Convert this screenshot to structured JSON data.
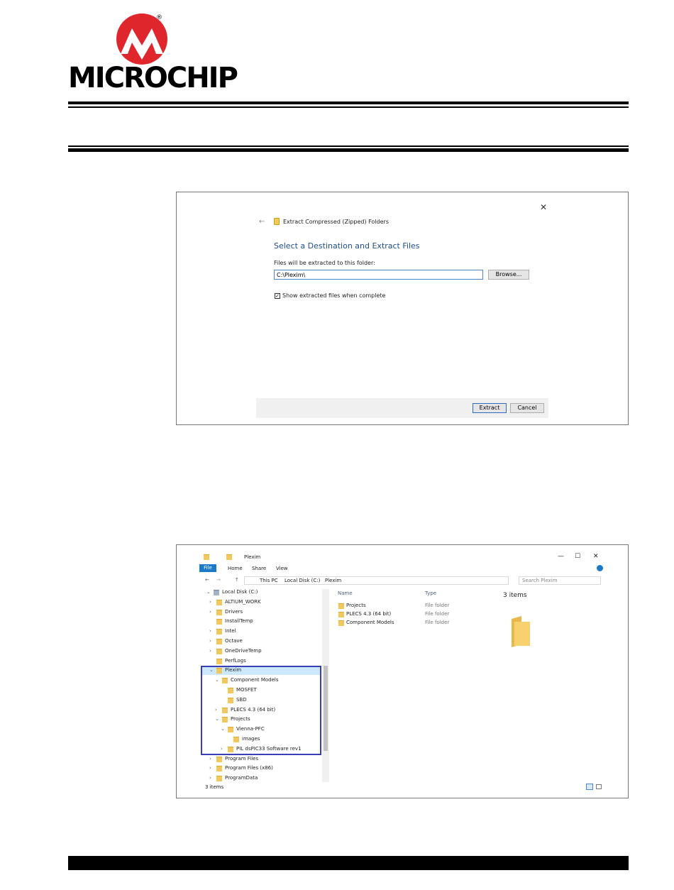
{
  "logo": {
    "name": "MICROCHIP",
    "registered": "®",
    "colors": {
      "mark": "#e0262d",
      "text": "#000000"
    }
  },
  "extract_dialog": {
    "back_arrow": "←",
    "title": "Extract Compressed (Zipped) Folders",
    "heading": "Select a Destination and Extract Files",
    "field_label": "Files will be extracted to this folder:",
    "path_value": "C:\\Plexim\\",
    "browse_label": "Browse...",
    "checkbox_checked": true,
    "checkbox_label": "Show extracted files when complete",
    "extract_label": "Extract",
    "cancel_label": "Cancel",
    "close_glyph": "✕"
  },
  "explorer": {
    "window_title": "Plexim",
    "ribbon_tabs": [
      "File",
      "Home",
      "Share",
      "View"
    ],
    "breadcrumb": [
      "This PC",
      "Local Disk (C:)",
      "Plexim"
    ],
    "search_placeholder": "Search Plexim",
    "window_controls": {
      "minimize": "—",
      "maximize": "☐",
      "close": "✕"
    },
    "nav_tree": [
      {
        "label": "Local Disk (C:)",
        "depth": 0,
        "expanded": true
      },
      {
        "label": "ALTIUM_WORK",
        "depth": 1,
        "expanded": false
      },
      {
        "label": "Drivers",
        "depth": 1,
        "expanded": false
      },
      {
        "label": "InstallTemp",
        "depth": 1,
        "expanded": null
      },
      {
        "label": "Intel",
        "depth": 1,
        "expanded": false
      },
      {
        "label": "Octave",
        "depth": 1,
        "expanded": false
      },
      {
        "label": "OneDriveTemp",
        "depth": 1,
        "expanded": false
      },
      {
        "label": "PerfLogs",
        "depth": 1,
        "expanded": null
      },
      {
        "label": "Plexim",
        "depth": 1,
        "expanded": true
      },
      {
        "label": "Component Models",
        "depth": 2,
        "expanded": true
      },
      {
        "label": "MOSFET",
        "depth": 3,
        "expanded": null
      },
      {
        "label": "SBD",
        "depth": 3,
        "expanded": null
      },
      {
        "label": "PLECS 4.3 (64 bit)",
        "depth": 2,
        "expanded": false
      },
      {
        "label": "Projects",
        "depth": 2,
        "expanded": true
      },
      {
        "label": "Vienna-PFC",
        "depth": 3,
        "expanded": true
      },
      {
        "label": "images",
        "depth": 4,
        "expanded": null
      },
      {
        "label": "PIL dsPIC33 Software rev1",
        "depth": 3,
        "expanded": false
      },
      {
        "label": "Program Files",
        "depth": 1,
        "expanded": false
      },
      {
        "label": "Program Files (x86)",
        "depth": 1,
        "expanded": false
      },
      {
        "label": "ProgramData",
        "depth": 1,
        "expanded": false
      }
    ],
    "columns": {
      "name": "Name",
      "type": "Type"
    },
    "files": [
      {
        "name": "Projects",
        "type": "File folder"
      },
      {
        "name": "PLECS 4.3 (64 bit)",
        "type": "File folder"
      },
      {
        "name": "Component Models",
        "type": "File folder"
      }
    ],
    "preview_count": "3 items",
    "status": "3 items"
  }
}
